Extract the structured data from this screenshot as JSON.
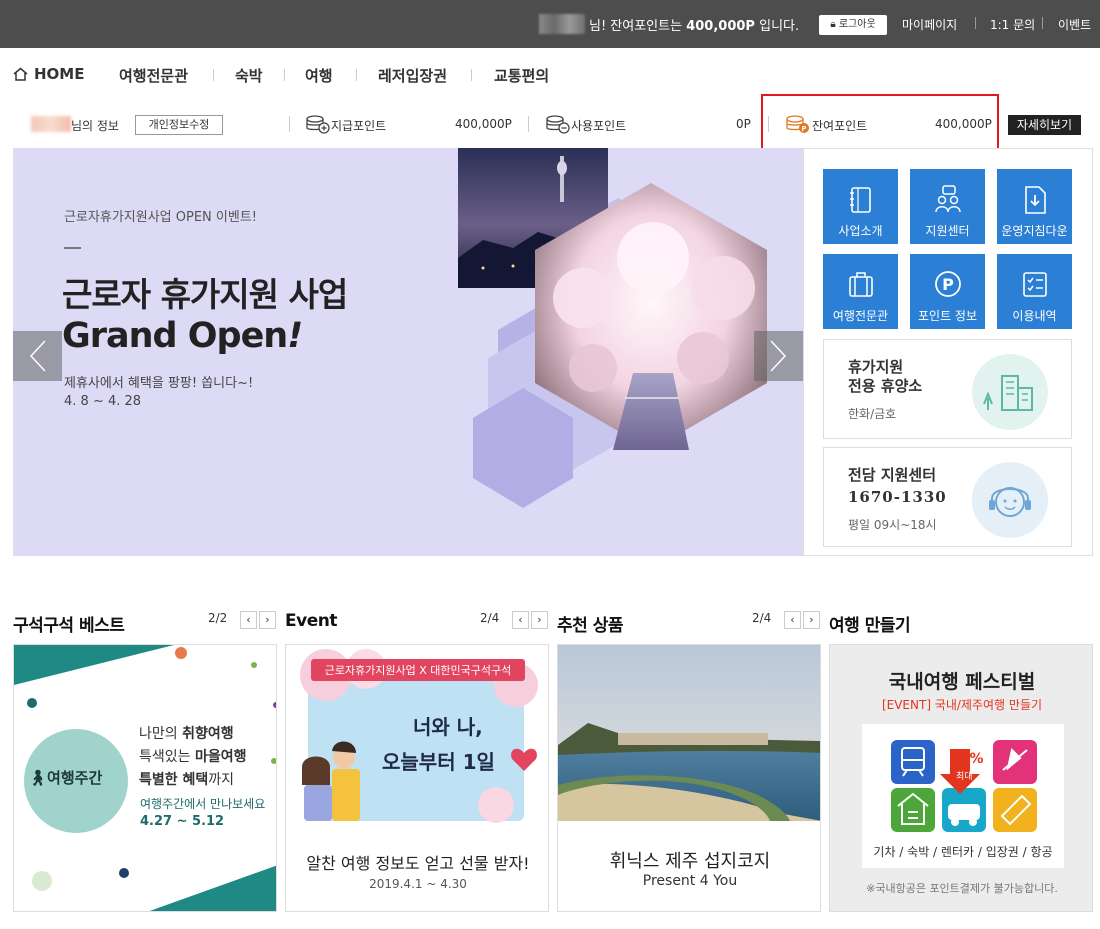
{
  "topbar": {
    "greeting_prefix": "님! 잔여포인트는",
    "points": "400,000P",
    "greeting_suffix": "입니다.",
    "logout_label": "로그아웃",
    "links": [
      "마이페이지",
      "1:1 문의",
      "이벤트"
    ]
  },
  "nav": {
    "home": "HOME",
    "items": [
      "여행전문관",
      "숙박",
      "여행",
      "레저입장권",
      "교통편의"
    ]
  },
  "info": {
    "owner_suffix": "님의 정보",
    "edit_button": "개인정보수정",
    "granted_label": "지급포인트",
    "granted_value": "400,000P",
    "used_label": "사용포인트",
    "used_value": "0P",
    "remaining_label": "잔여포인트",
    "remaining_value": "400,000P",
    "detail_button": "자세히보기"
  },
  "hero": {
    "subtitle": "근로자휴가지원사업 OPEN 이벤트!",
    "title_line1": "근로자 휴가지원 사업",
    "title_line2": "Grand Open",
    "title_excl": "!",
    "desc": "제휴사에서 혜택을 팡팡! 쏩니다~!",
    "date": "4. 8 ~ 4. 28"
  },
  "side": {
    "tiles": [
      "사업소개",
      "지원센터",
      "운영지침다운",
      "여행전문관",
      "포인트 정보",
      "이용내역"
    ],
    "resort_title1": "휴가지원",
    "resort_title2": "전용 휴양소",
    "resort_sub": "한화/금호",
    "support_title": "전담 지원센터",
    "support_phone": "1670-1330",
    "support_hours": "평일 09시~18시"
  },
  "sections": {
    "best": {
      "title": "구석구석 베스트",
      "pager": "2/2"
    },
    "event": {
      "title": "Event",
      "pager": "2/4"
    },
    "recommend": {
      "title": "추천 상품",
      "pager": "2/4"
    },
    "make": {
      "title": "여행 만들기"
    }
  },
  "best_card": {
    "logo_text": "여행주간",
    "line1a": "나만의 ",
    "line1b": "취향여행",
    "line2a": "특색있는 ",
    "line2b": "마을여행",
    "line3a": "특별한 혜택",
    "line3b": "까지",
    "line4": "여행주간에서 만나보세요",
    "dates": "4.27 ~ 5.12"
  },
  "event_card": {
    "ribbon": "근로자휴가지원사업 X 대한민국구석구석",
    "banner1": "너와 나,",
    "banner2": "오늘부터 1일",
    "caption": "알찬 여행 정보도 얻고 선물 받자!",
    "date": "2019.4.1 ~ 4.30"
  },
  "recommend_card": {
    "caption": "휘닉스 제주 섭지코지",
    "sub": "Present 4 You"
  },
  "make_card": {
    "title": "국내여행 페스티벌",
    "sub": "[EVENT] 국내/제주여행 만들기",
    "discount": "35%",
    "discount_sub": "최대",
    "categories": "기차 / 숙박 / 렌터카 / 입장권 / 항공",
    "note": "※국내항공은 포인트결제가 불가능합니다."
  },
  "colors": {
    "tile_blue": "#2b7fd4",
    "topbar": "#4d4d4d",
    "hero_bg": "#dcdaf5",
    "highlight_red": "#e01b1b",
    "point_orange": "#e07a1c"
  }
}
